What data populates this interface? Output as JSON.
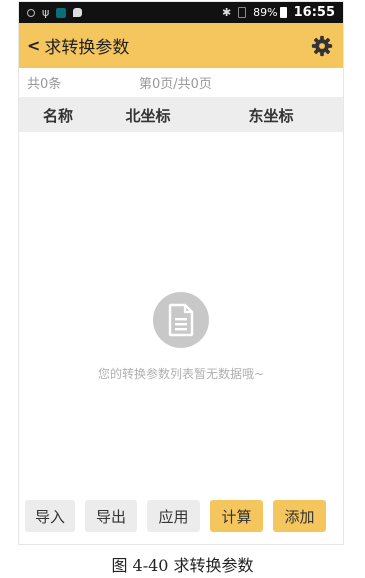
{
  "status_bar": {
    "left_icons": [
      "target-icon",
      "usb-icon",
      "app-icon",
      "message-icon"
    ],
    "right_icons": [
      "bluetooth-icon",
      "no-sim-icon"
    ],
    "battery": "89%",
    "time": "16:55"
  },
  "app_bar": {
    "title": "求转换参数",
    "settings_icon": "gear-icon",
    "color": "#f5c55e"
  },
  "info_bar": {
    "count": "共0条",
    "page": "第0页/共0页"
  },
  "table": {
    "columns": [
      "名称",
      "北坐标",
      "东坐标"
    ]
  },
  "empty_state": {
    "icon": "document-icon",
    "message": "您的转换参数列表暂无数据哦~"
  },
  "actions": [
    {
      "label": "导入"
    },
    {
      "label": "导出"
    },
    {
      "label": "应用"
    },
    {
      "label": "计算"
    },
    {
      "label": "添加"
    }
  ],
  "caption": "图 4-40 求转换参数"
}
